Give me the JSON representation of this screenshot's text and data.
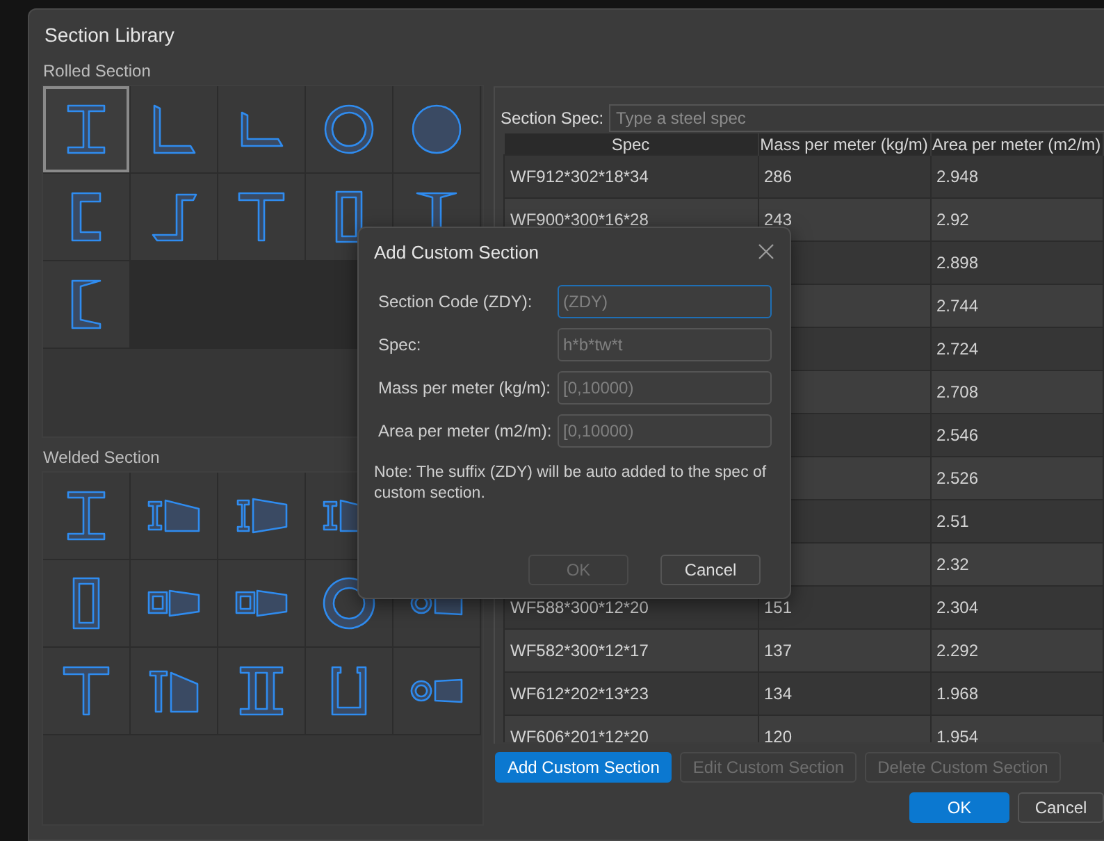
{
  "window": {
    "title": "Section Library"
  },
  "rolled_section": {
    "label": "Rolled Section",
    "items": [
      {
        "kind": "i-beam",
        "selected": true
      },
      {
        "kind": "angle",
        "selected": false
      },
      {
        "kind": "short-angle",
        "selected": false
      },
      {
        "kind": "pipe",
        "selected": false
      },
      {
        "kind": "round-bar",
        "selected": false
      },
      {
        "kind": "channel",
        "selected": false
      },
      {
        "kind": "z-section",
        "selected": false
      },
      {
        "kind": "tee",
        "selected": false
      },
      {
        "kind": "box",
        "selected": false
      },
      {
        "kind": "tapered-tee",
        "selected": false
      },
      {
        "kind": "tapered-channel",
        "selected": false
      }
    ]
  },
  "welded_section": {
    "label": "Welded Section",
    "items": [
      {
        "kind": "i-beam",
        "selected": false
      },
      {
        "kind": "tapered-i-beam",
        "selected": false
      },
      {
        "kind": "wide-tapered-i-beam",
        "selected": false
      },
      {
        "kind": "tapered-i-beam",
        "selected": false
      },
      {
        "kind": "hidden"
      },
      {
        "kind": "box",
        "selected": false
      },
      {
        "kind": "tapered-box",
        "selected": false
      },
      {
        "kind": "tapered-box",
        "selected": false
      },
      {
        "kind": "thick-pipe",
        "selected": false
      },
      {
        "kind": "tapered-pipe",
        "selected": false
      },
      {
        "kind": "tee",
        "selected": false
      },
      {
        "kind": "tee-with-taper",
        "selected": false
      },
      {
        "kind": "double-i-beam",
        "selected": false
      },
      {
        "kind": "u-channel",
        "selected": false
      },
      {
        "kind": "tapered-pipe",
        "selected": false
      }
    ]
  },
  "search": {
    "label": "Section Spec:",
    "placeholder": "Type a steel spec"
  },
  "table": {
    "columns": [
      "Spec",
      "Mass per meter (kg/m)",
      "Area per meter (m2/m)"
    ],
    "rows": [
      {
        "spec": "WF912*302*18*34",
        "mass": "286",
        "area": "2.948"
      },
      {
        "spec": "WF900*300*16*28",
        "mass": "243",
        "area": "2.92"
      },
      {
        "area": "2.898"
      },
      {
        "area": "2.744"
      },
      {
        "area": "2.724"
      },
      {
        "area": "2.708"
      },
      {
        "area": "2.546"
      },
      {
        "area": "2.526"
      },
      {
        "area": "2.51"
      },
      {
        "area": "2.32"
      },
      {
        "spec": "WF588*300*12*20",
        "mass": "151",
        "area": "2.304"
      },
      {
        "spec": "WF582*300*12*17",
        "mass": "137",
        "area": "2.292"
      },
      {
        "spec": "WF612*202*13*23",
        "mass": "134",
        "area": "1.968"
      },
      {
        "spec": "WF606*201*12*20",
        "mass": "120",
        "area": "1.954"
      }
    ]
  },
  "actions": [
    {
      "label": "Add Custom Section",
      "primary": true,
      "disabled": false
    },
    {
      "label": "Edit Custom Section",
      "primary": false,
      "disabled": true
    },
    {
      "label": "Delete Custom Section",
      "primary": false,
      "disabled": true
    }
  ],
  "footer_buttons": [
    {
      "label": "OK",
      "primary": true
    },
    {
      "label": "Cancel",
      "primary": false
    }
  ],
  "custom_dialog": {
    "title": "Add Custom Section",
    "fields": [
      {
        "label": "Section Code (ZDY):",
        "placeholder": "(ZDY)",
        "focused": true
      },
      {
        "label": "Spec:",
        "placeholder": "h*b*tw*t",
        "focused": false
      },
      {
        "label": "Mass per meter (kg/m):",
        "placeholder": "[0,10000)",
        "focused": false
      },
      {
        "label": "Area per meter (m2/m):",
        "placeholder": "[0,10000)",
        "focused": false
      }
    ],
    "note": "Note: The suffix (ZDY) will be auto added to the spec of custom section.",
    "buttons": [
      {
        "label": "OK",
        "disabled": true
      },
      {
        "label": "Cancel",
        "disabled": false
      }
    ]
  }
}
